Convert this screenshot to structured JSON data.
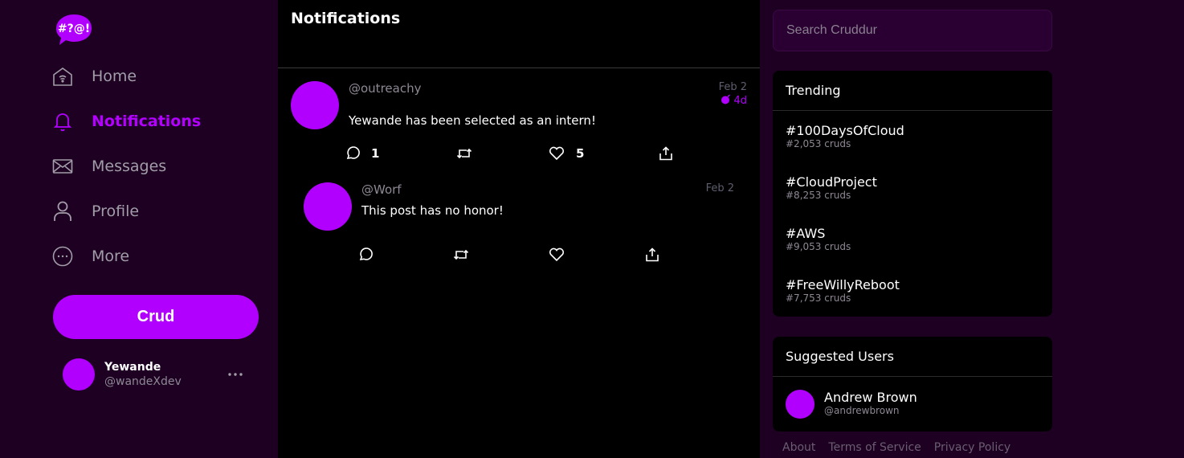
{
  "brand": {
    "logo_text": "#?@!",
    "accent": "#b200ff"
  },
  "nav": {
    "items": [
      {
        "label": "Home",
        "icon": "home-icon"
      },
      {
        "label": "Notifications",
        "icon": "bell-icon"
      },
      {
        "label": "Messages",
        "icon": "envelope-icon"
      },
      {
        "label": "Profile",
        "icon": "person-icon"
      },
      {
        "label": "More",
        "icon": "more-circle-icon"
      }
    ],
    "active": "Notifications"
  },
  "compose": {
    "label": "Crud"
  },
  "current_user": {
    "name": "Yewande",
    "handle": "@wandeXdev"
  },
  "feed": {
    "title": "Notifications",
    "activities": [
      {
        "handle": "@outreachy",
        "date": "Feb 2",
        "expires": "4d",
        "message": "Yewande has been selected as an intern!",
        "reply_count": "1",
        "like_count": "5"
      },
      {
        "handle": "@Worf",
        "date": "Feb 2",
        "message": "This post has no honor!"
      }
    ]
  },
  "search": {
    "placeholder": "Search Cruddur"
  },
  "trending": {
    "title": "Trending",
    "items": [
      {
        "tag": "#100DaysOfCloud",
        "count": "#2,053 cruds"
      },
      {
        "tag": "#CloudProject",
        "count": "#8,253 cruds"
      },
      {
        "tag": "#AWS",
        "count": "#9,053 cruds"
      },
      {
        "tag": "#FreeWillyReboot",
        "count": "#7,753 cruds"
      }
    ]
  },
  "suggested": {
    "title": "Suggested Users",
    "users": [
      {
        "name": "Andrew Brown",
        "handle": "@andrewbrown"
      }
    ]
  },
  "footer": {
    "links": [
      "About",
      "Terms of Service",
      "Privacy Policy"
    ]
  }
}
